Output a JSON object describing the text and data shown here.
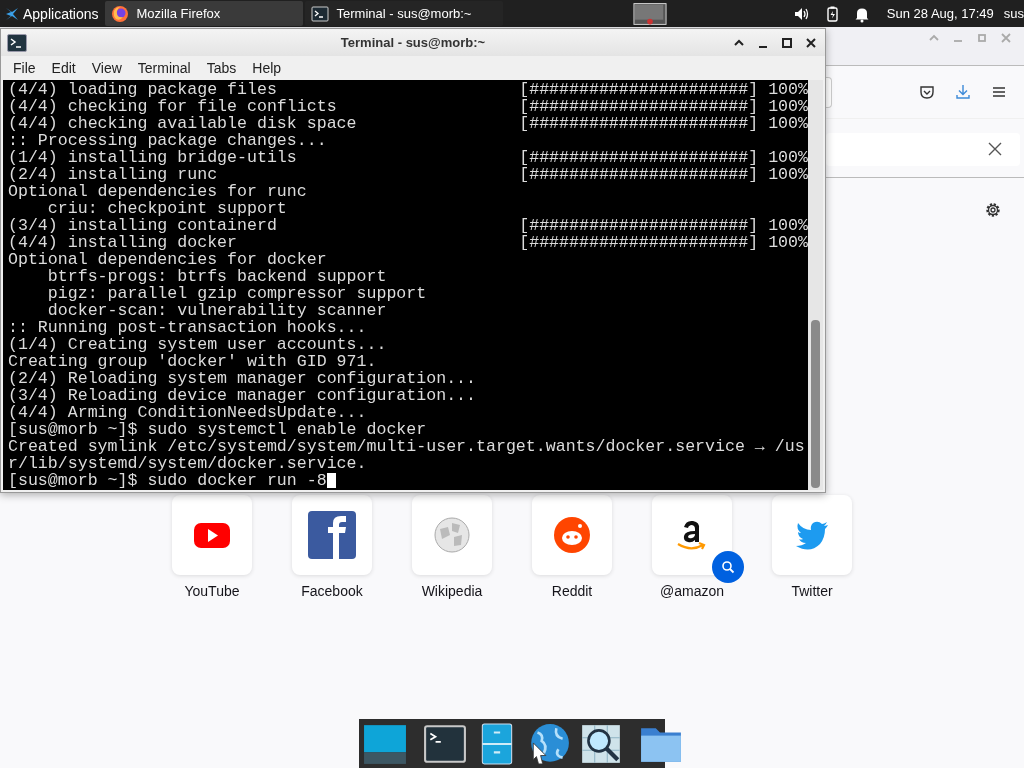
{
  "top_panel": {
    "applications": "Applications",
    "tasks": [
      {
        "title": "Mozilla Firefox",
        "kind": "firefox",
        "selected": false
      },
      {
        "title": "Terminal - sus@morb:~",
        "kind": "terminal",
        "selected": true
      }
    ],
    "clock": "Sun 28 Aug, 17:49",
    "user": "sus"
  },
  "terminal": {
    "title": "Terminal - sus@morb:~",
    "menu": [
      "File",
      "Edit",
      "View",
      "Terminal",
      "Tabs",
      "Help"
    ],
    "lines": [
      {
        "text": "(4/4) loading package files",
        "progress": "[######################] 100%"
      },
      {
        "text": "(4/4) checking for file conflicts",
        "progress": "[######################] 100%"
      },
      {
        "text": "(4/4) checking available disk space",
        "progress": "[######################] 100%"
      },
      {
        "text": ":: Processing package changes..."
      },
      {
        "text": "(1/4) installing bridge-utils",
        "progress": "[######################] 100%"
      },
      {
        "text": "(2/4) installing runc",
        "progress": "[######################] 100%"
      },
      {
        "text": "Optional dependencies for runc"
      },
      {
        "text": "    criu: checkpoint support"
      },
      {
        "text": "(3/4) installing containerd",
        "progress": "[######################] 100%"
      },
      {
        "text": "(4/4) installing docker",
        "progress": "[######################] 100%"
      },
      {
        "text": "Optional dependencies for docker"
      },
      {
        "text": "    btrfs-progs: btrfs backend support"
      },
      {
        "text": "    pigz: parallel gzip compressor support"
      },
      {
        "text": "    docker-scan: vulnerability scanner"
      },
      {
        "text": ":: Running post-transaction hooks..."
      },
      {
        "text": "(1/4) Creating system user accounts..."
      },
      {
        "text": "Creating group 'docker' with GID 971."
      },
      {
        "text": "(2/4) Reloading system manager configuration..."
      },
      {
        "text": "(3/4) Reloading device manager configuration..."
      },
      {
        "text": "(4/4) Arming ConditionNeedsUpdate..."
      },
      {
        "text": "[sus@morb ~]$ sudo systemctl enable docker"
      },
      {
        "text": "Created symlink /etc/systemd/system/multi-user.target.wants/docker.service → /us"
      },
      {
        "text": "r/lib/systemd/system/docker.service."
      },
      {
        "text": "[sus@morb ~]$ sudo docker run -8"
      }
    ]
  },
  "firefox": {
    "shortcuts": [
      {
        "label": "YouTube",
        "kind": "youtube"
      },
      {
        "label": "Facebook",
        "kind": "facebook"
      },
      {
        "label": "Wikipedia",
        "kind": "wikipedia"
      },
      {
        "label": "Reddit",
        "kind": "reddit"
      },
      {
        "label": "@amazon",
        "kind": "amazon"
      },
      {
        "label": "Twitter",
        "kind": "twitter"
      }
    ]
  },
  "dock": [
    {
      "kind": "workspace"
    },
    {
      "kind": "separator"
    },
    {
      "kind": "terminal"
    },
    {
      "kind": "files"
    },
    {
      "kind": "browser"
    },
    {
      "kind": "image-viewer"
    },
    {
      "kind": "separator"
    },
    {
      "kind": "folder"
    }
  ]
}
